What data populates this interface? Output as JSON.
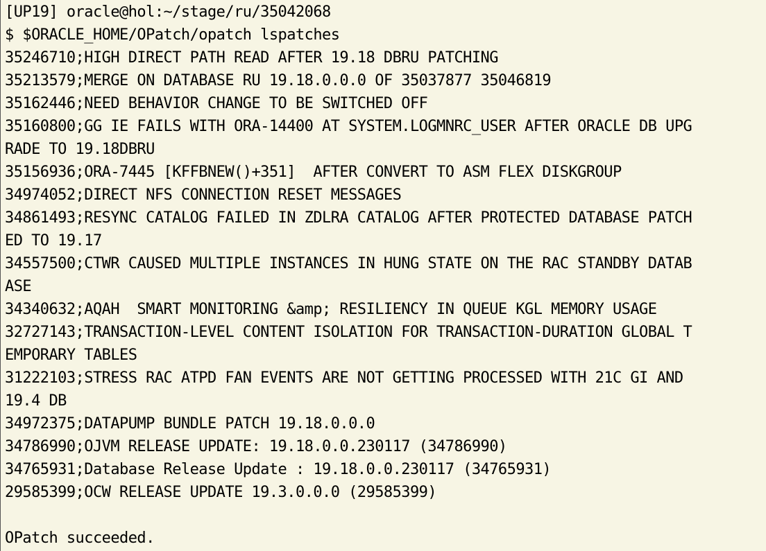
{
  "terminal": {
    "lines": [
      "[UP19] oracle@hol:~/stage/ru/35042068",
      "$ $ORACLE_HOME/OPatch/opatch lspatches",
      "35246710;HIGH DIRECT PATH READ AFTER 19.18 DBRU PATCHING",
      "35213579;MERGE ON DATABASE RU 19.18.0.0.0 OF 35037877 35046819",
      "35162446;NEED BEHAVIOR CHANGE TO BE SWITCHED OFF",
      "35160800;GG IE FAILS WITH ORA-14400 AT SYSTEM.LOGMNRC_USER AFTER ORACLE DB UPG",
      "RADE TO 19.18DBRU",
      "35156936;ORA-7445 [KFFBNEW()+351]  AFTER CONVERT TO ASM FLEX DISKGROUP",
      "34974052;DIRECT NFS CONNECTION RESET MESSAGES",
      "34861493;RESYNC CATALOG FAILED IN ZDLRA CATALOG AFTER PROTECTED DATABASE PATCH",
      "ED TO 19.17",
      "34557500;CTWR CAUSED MULTIPLE INSTANCES IN HUNG STATE ON THE RAC STANDBY DATAB",
      "ASE",
      "34340632;AQAH  SMART MONITORING &amp; RESILIENCY IN QUEUE KGL MEMORY USAGE",
      "32727143;TRANSACTION-LEVEL CONTENT ISOLATION FOR TRANSACTION-DURATION GLOBAL T",
      "EMPORARY TABLES",
      "31222103;STRESS RAC ATPD FAN EVENTS ARE NOT GETTING PROCESSED WITH 21C GI AND",
      "19.4 DB",
      "34972375;DATAPUMP BUNDLE PATCH 19.18.0.0.0",
      "34786990;OJVM RELEASE UPDATE: 19.18.0.0.230117 (34786990)",
      "34765931;Database Release Update : 19.18.0.0.230117 (34765931)",
      "29585399;OCW RELEASE UPDATE 19.3.0.0.0 (29585399)",
      "",
      "OPatch succeeded."
    ]
  },
  "colors": {
    "background": "#f7f5e4",
    "text": "#000000"
  }
}
